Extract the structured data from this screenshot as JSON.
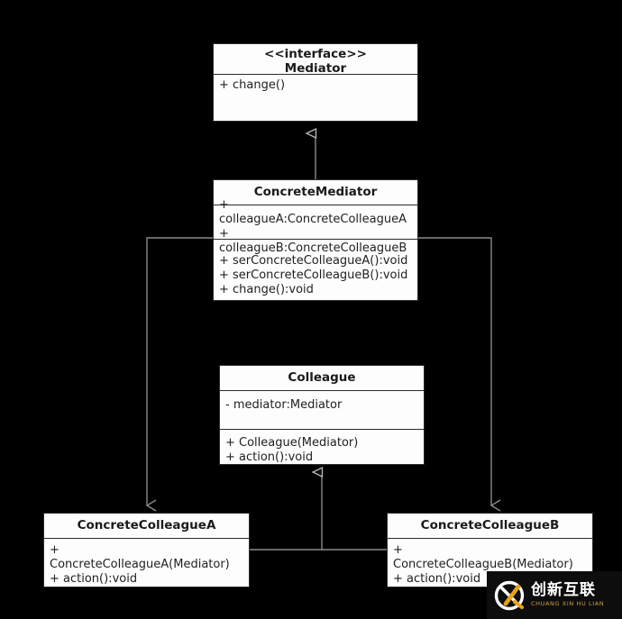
{
  "diagram": {
    "title": "Mediator Pattern UML Class Diagram",
    "background_color": "#000000",
    "box_fill": "#fdfdfd",
    "box_stroke": "#2b2b2b",
    "connector_color": "#8a8a8a"
  },
  "classes": {
    "mediator": {
      "stereotype": "<<interface>>",
      "name": "Mediator",
      "operations": [
        "+ change()"
      ]
    },
    "concrete_mediator": {
      "name": "ConcreteMediator",
      "attributes": [
        "+",
        "colleagueA:ConcreteColleagueA",
        "+",
        "colleagueB:ConcreteColleagueB"
      ],
      "operations": [
        "+ serConcreteColleagueA():void",
        "+ serConcreteColleagueB():void",
        "+ change():void"
      ]
    },
    "colleague": {
      "name": "Colleague",
      "attributes": [
        "- mediator:Mediator"
      ],
      "operations": [
        "+ Colleague(Mediator)",
        "+ action():void"
      ]
    },
    "concrete_colleague_a": {
      "name": "ConcreteColleagueA",
      "operations": [
        "+",
        "ConcreteColleagueA(Mediator)",
        "+ action():void"
      ]
    },
    "concrete_colleague_b": {
      "name": "ConcreteColleagueB",
      "operations": [
        "+",
        "ConcreteColleagueB(Mediator)",
        "+ action():void"
      ]
    }
  },
  "relationships": [
    {
      "from": "ConcreteMediator",
      "to": "Mediator",
      "type": "realization",
      "arrow": "hollow-triangle"
    },
    {
      "from": "ConcreteColleagueA",
      "to": "Colleague",
      "type": "generalization",
      "arrow": "hollow-triangle"
    },
    {
      "from": "ConcreteColleagueB",
      "to": "Colleague",
      "type": "generalization",
      "arrow": "hollow-triangle"
    },
    {
      "from": "ConcreteMediator",
      "to": "ConcreteColleagueA",
      "type": "association",
      "arrow": "open-arrow"
    },
    {
      "from": "ConcreteMediator",
      "to": "ConcreteColleagueB",
      "type": "association",
      "arrow": "open-arrow"
    }
  ],
  "watermark": {
    "chinese": "创新互联",
    "pinyin": "CHUANG XIN HU LIAN",
    "logo_icon": "circle-x-logo-icon",
    "accent_color": "#e8a317"
  }
}
